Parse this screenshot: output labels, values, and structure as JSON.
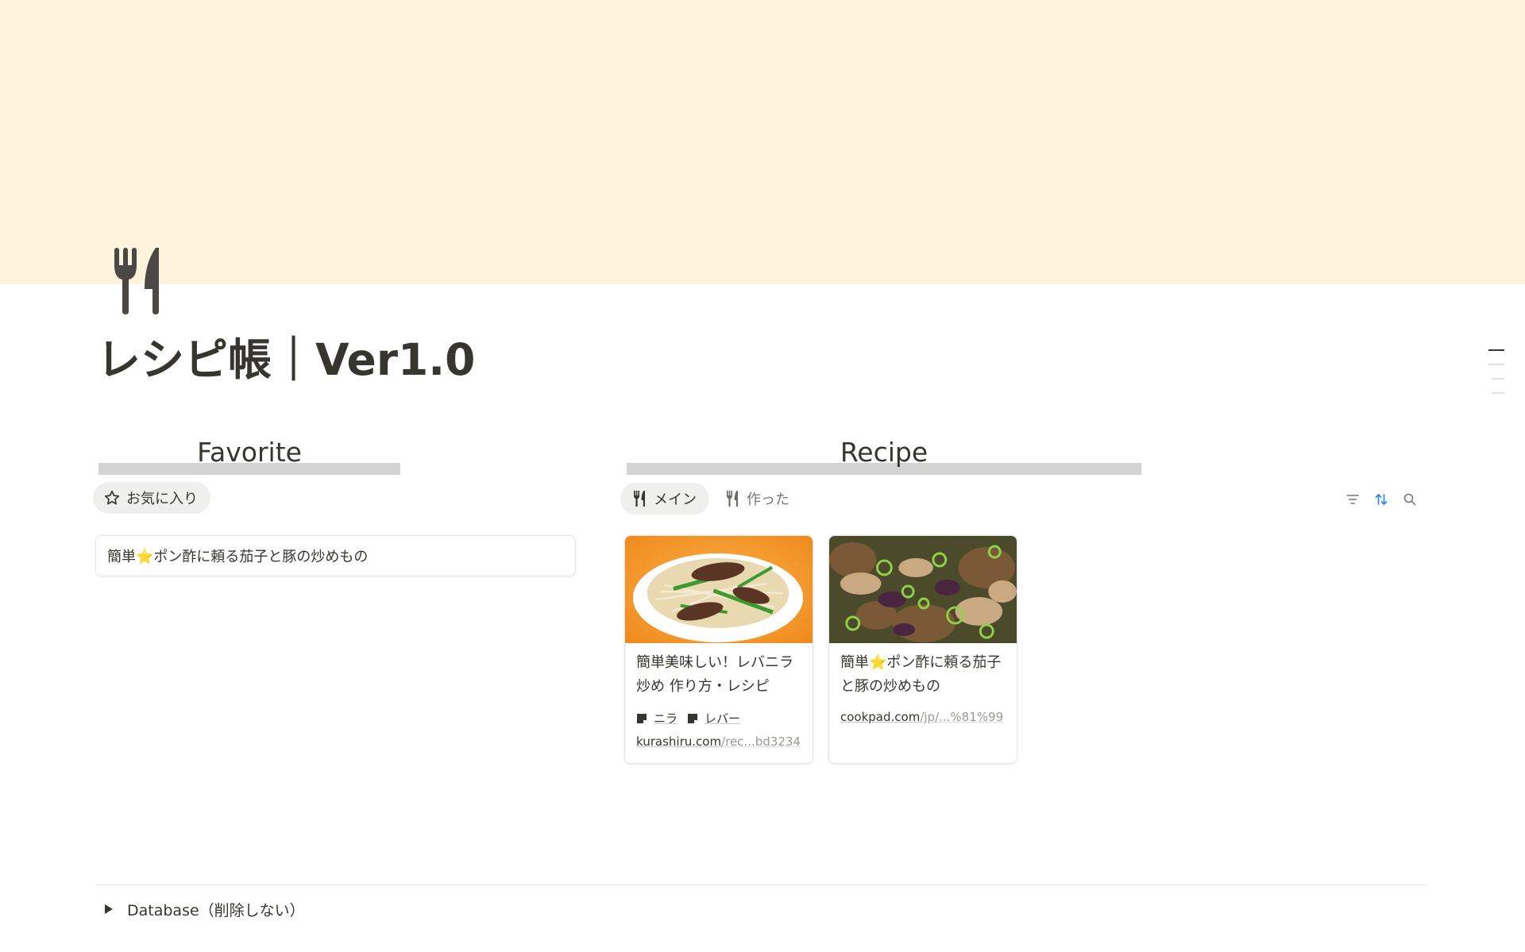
{
  "page": {
    "cover_color": "#fdf2dc",
    "icon": "fork-knife-icon",
    "title": "レシピ帳｜Ver1.0"
  },
  "favorite_section": {
    "heading": "Favorite",
    "view_tab": {
      "label": "お気に入り",
      "icon": "star-outline-icon"
    },
    "items": [
      {
        "title": "簡単⭐ポン酢に頼る茄子と豚の炒めもの"
      }
    ]
  },
  "recipe_section": {
    "heading": "Recipe",
    "view_tabs": [
      {
        "label": "メイン",
        "icon": "fork-knife-icon",
        "active": true
      },
      {
        "label": "作った",
        "icon": "fork-knife-icon",
        "active": false
      }
    ],
    "toolbar": {
      "filter_icon": "filter-icon",
      "sort_icon": "sort-icon",
      "search_icon": "search-icon",
      "sort_color": "#2383e2"
    },
    "cards": [
      {
        "title": "簡単美味しい！レバニラ炒め 作り方・レシピ",
        "tags": [
          "ニラ",
          "レバー"
        ],
        "url_domain": "kurashiru.com",
        "url_path": "/rec...bd3234"
      },
      {
        "title": "簡単⭐ポン酢に頼る茄子と豚の炒めもの",
        "tags": [],
        "url_domain": "cookpad.com",
        "url_path": "/jp/...%81%99"
      }
    ]
  },
  "footer_toggle": {
    "label": "Database（削除しない）"
  }
}
